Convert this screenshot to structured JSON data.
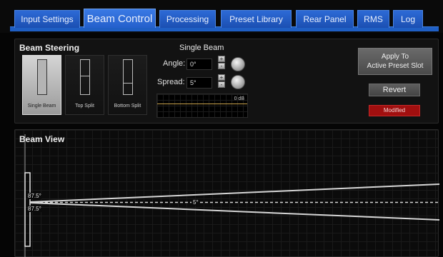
{
  "tabs": [
    {
      "label": "Input Settings"
    },
    {
      "label": "Beam Control"
    },
    {
      "label": "Processing"
    },
    {
      "label": "Preset Library"
    },
    {
      "label": "Rear Panel"
    },
    {
      "label": "RMS"
    },
    {
      "label": "Log"
    }
  ],
  "beam_steering": {
    "title": "Beam Steering",
    "modes": [
      {
        "label": "Single Beam",
        "selected": true
      },
      {
        "label": "Top Split",
        "selected": false
      },
      {
        "label": "Bottom Split",
        "selected": false
      }
    ]
  },
  "single_beam": {
    "title": "Single Beam",
    "angle_label": "Angle:",
    "angle_value": "0°",
    "spread_label": "Spread:",
    "spread_value": "5°",
    "step_up": "+",
    "step_down": "-",
    "meter_label": "0 dB"
  },
  "actions": {
    "apply_label_1": "Apply To",
    "apply_label_2": "Active Preset Slot",
    "revert_label": "Revert",
    "status_label": "Modified"
  },
  "beam_view": {
    "title": "Beam View",
    "upper_angle": "87.5°",
    "lower_angle": "87.5°",
    "spread_value": "5°"
  },
  "colors": {
    "tab_blue": "#1f5fc4",
    "modified_red": "#a10f0f",
    "meter_line": "#c9a14a"
  }
}
